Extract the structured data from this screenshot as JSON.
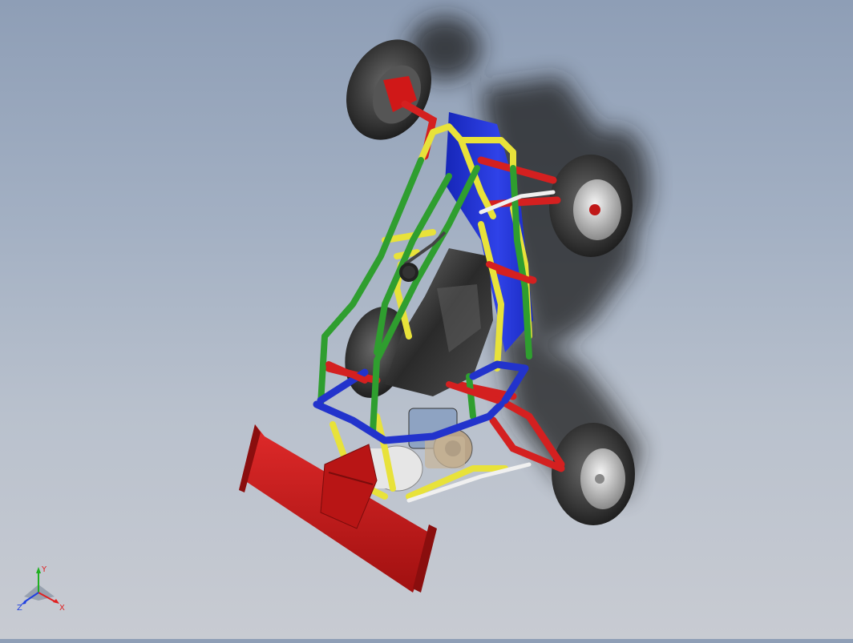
{
  "viewport": {
    "model": "off-road-buggy-assembly",
    "colors": {
      "background_top": "#8e9eb6",
      "background_bottom": "#c8cbd2",
      "frame_yellow": "#e8e23a",
      "frame_green": "#2f9e2f",
      "frame_blue": "#2233cc",
      "frame_red": "#d42020",
      "panel_blue": "#1f2fd0",
      "wing_red": "#c41a1a",
      "tire": "#3a3a3a",
      "seat": "#2e2e2e",
      "engine": "#b6a48a"
    }
  },
  "triad": {
    "x_label": "X",
    "y_label": "Y",
    "z_label": "Z",
    "x_color": "#e02020",
    "y_color": "#20b020",
    "z_color": "#2040e0"
  }
}
